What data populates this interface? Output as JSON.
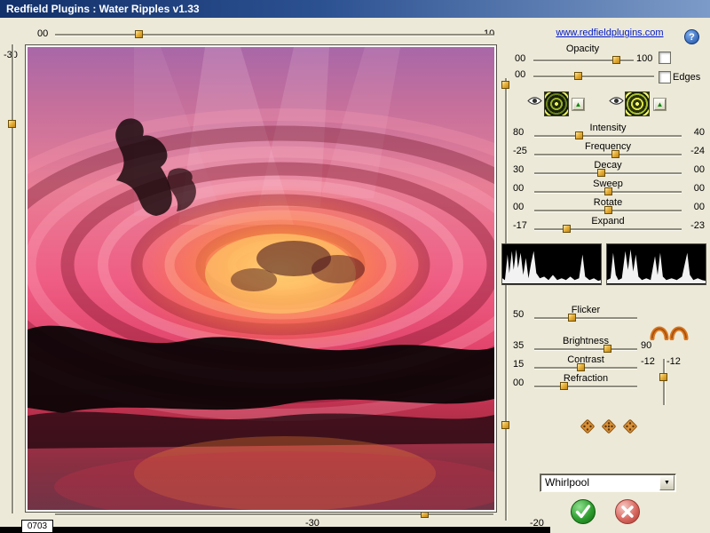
{
  "window": {
    "title": "Redfield Plugins : Water Ripples v1.33"
  },
  "header": {
    "link": "www.redfieldplugins.com",
    "help": "?"
  },
  "frame": {
    "top_left": "00",
    "top_right": "10",
    "left_top": "-30",
    "bottom_center": "-30",
    "bottom_right": "-20",
    "counter": "0703"
  },
  "opacity": {
    "label": "Opacity",
    "left": "00",
    "right": "100"
  },
  "layer2": {
    "left": "00",
    "edges": "Edges"
  },
  "icons": {
    "up": "▲",
    "dropdown_arrow": "▼"
  },
  "sliders": [
    {
      "label": "Intensity",
      "left": "80",
      "right": "40"
    },
    {
      "label": "Frequency",
      "left": "-25",
      "right": "-24"
    },
    {
      "label": "Decay",
      "left": "30",
      "right": "00"
    },
    {
      "label": "Sweep",
      "left": "00",
      "right": "00"
    },
    {
      "label": "Rotate",
      "left": "00",
      "right": "00"
    },
    {
      "label": "Expand",
      "left": "-17",
      "right": "-23"
    }
  ],
  "adjust": [
    {
      "label": "Flicker",
      "left": "50",
      "right": ""
    },
    {
      "label": "Brightness",
      "left": "35",
      "right": "90"
    },
    {
      "label": "Contrast",
      "left": "15",
      "right": ""
    },
    {
      "label": "Refraction",
      "left": "00",
      "right": ""
    }
  ],
  "depth": {
    "left": "-12",
    "right": "-12"
  },
  "preset": {
    "value": "Whirlpool"
  },
  "colors": {
    "dialog_bg": "#ece9d8",
    "titlebar_blue": "#2c5191",
    "handle_gold": "#e8b23c",
    "link_blue": "#0018c8",
    "ok_green": "#2f9e2f",
    "cancel_red": "#d96a62"
  }
}
